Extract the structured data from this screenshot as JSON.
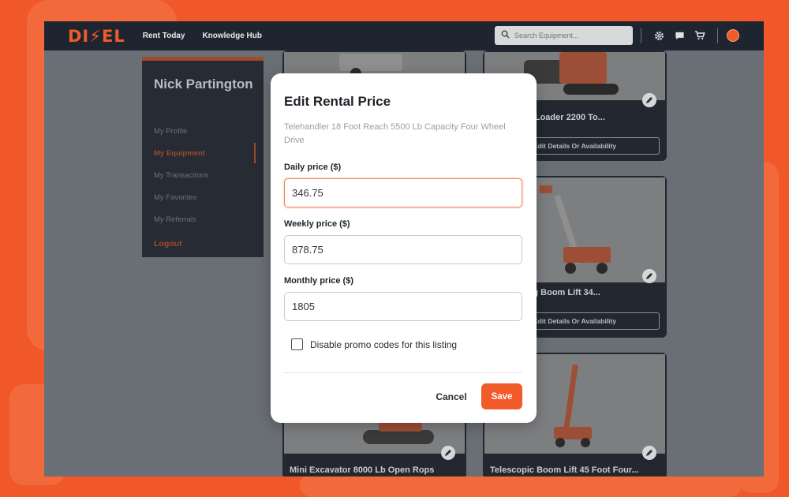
{
  "brand": {
    "logo_text": "DI⚡EL",
    "accent": "#f15a29"
  },
  "nav": {
    "links": [
      "Rent Today",
      "Knowledge Hub"
    ],
    "search_placeholder": "Search Equipment...",
    "icons": [
      "search-icon",
      "gear-icon",
      "chat-icon",
      "cart-icon",
      "avatar-icon"
    ]
  },
  "sidebar": {
    "user_name": "Nick Partington",
    "items": [
      "My Profile",
      "My Equipment",
      "My Transactions",
      "My Favorites",
      "My Referrals"
    ],
    "active_item": "My Equipment",
    "logout_label": "Logout"
  },
  "cards": [
    {
      "title": "Skid Steer Loader 2200 To...",
      "action": "Edit Details Or Availability"
    },
    {
      "title": "Articulating Boom Lift 34...",
      "action": "Edit Details Or Availability"
    },
    {
      "title": "Mini Excavator 8000 Lb Open Rops",
      "action": ""
    },
    {
      "title": "Telescopic Boom Lift 45 Foot Four...",
      "action": ""
    }
  ],
  "modal": {
    "title": "Edit Rental Price",
    "subtitle": "Telehandler 18 Foot Reach 5500 Lb Capacity Four Wheel Drive",
    "daily_label": "Daily price ($)",
    "daily_value": "346.75",
    "weekly_label": "Weekly price ($)",
    "weekly_value": "878.75",
    "monthly_label": "Monthly price ($)",
    "monthly_value": "1805",
    "checkbox_label": "Disable promo codes for this listing",
    "checkbox_checked": false,
    "cancel_label": "Cancel",
    "save_label": "Save"
  }
}
